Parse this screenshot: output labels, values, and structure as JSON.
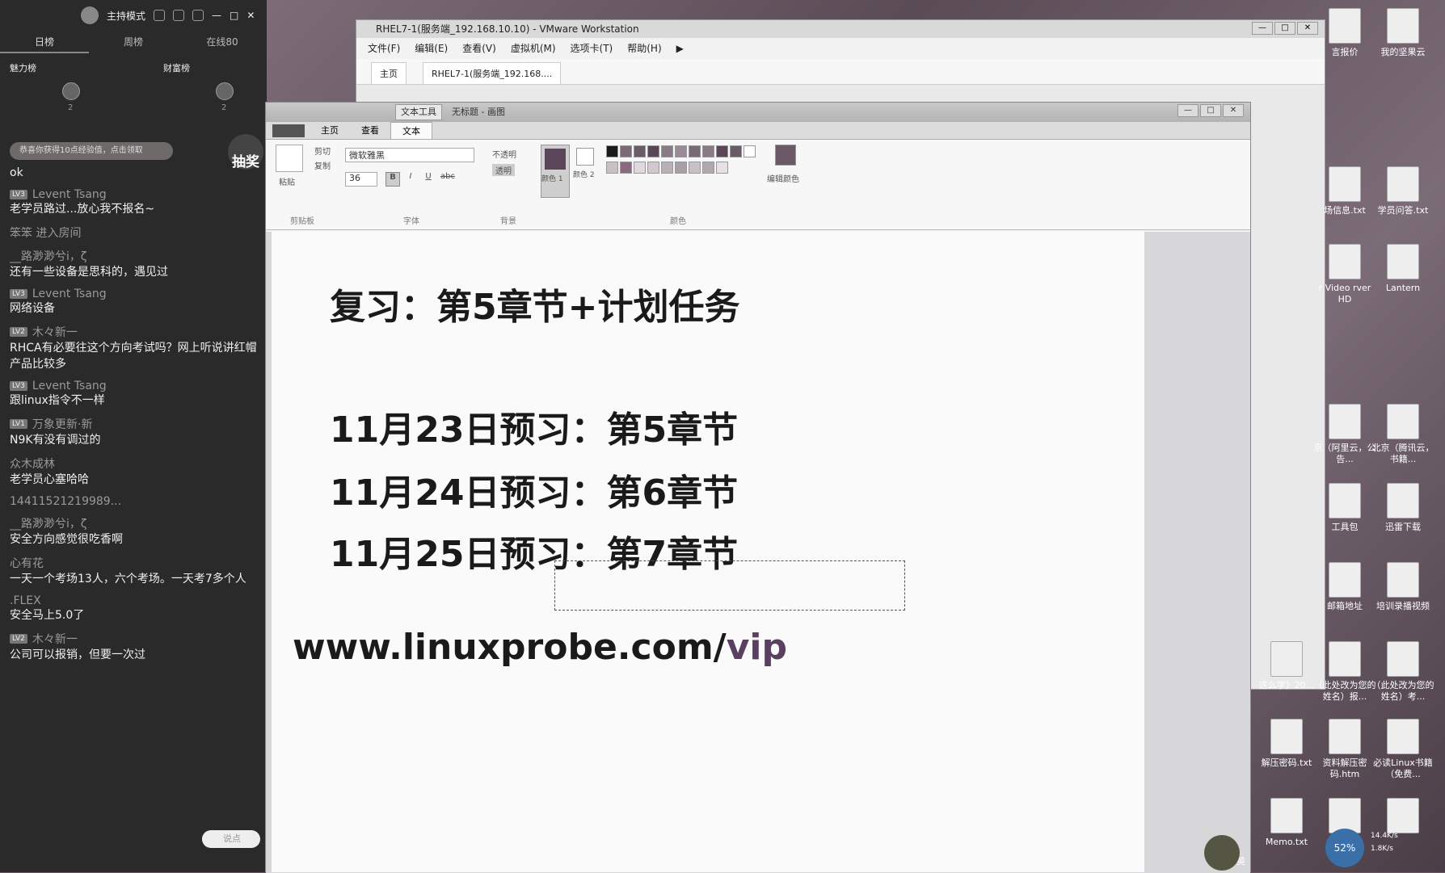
{
  "live": {
    "mode": "主持模式",
    "tabs": [
      "日榜",
      "周榜",
      "在线80"
    ],
    "rank_left": "魅力榜",
    "rank_right": "财富榜",
    "rank_left_count": "2",
    "rank_right_count": "2",
    "promo": "恭喜你获得10点经验值，点击领取",
    "lottery": "抽奖",
    "first_msg": "ok",
    "messages": [
      {
        "user": "Levent Tsang",
        "badge": "LV3",
        "text": "老学员路过...放心我不报名~"
      },
      {
        "system": "笨笨 进入房间"
      },
      {
        "user": "__路渺渺兮i，ζ",
        "badge": "",
        "text": "还有一些设备是思科的，遇见过"
      },
      {
        "user": "Levent Tsang",
        "badge": "LV3",
        "text": "网络设备"
      },
      {
        "user": "木々新一",
        "badge": "LV2",
        "text": "RHCA有必要往这个方向考试吗？网上听说讲红帽产品比较多"
      },
      {
        "user": "Levent Tsang",
        "badge": "LV3",
        "text": "跟linux指令不一样"
      },
      {
        "user": "万象更新·新",
        "badge": "LV1",
        "text": "N9K有没有调过的"
      },
      {
        "user": "众木成林",
        "badge": "",
        "text": "老学员心塞哈哈"
      },
      {
        "user": "14411521219989...",
        "badge": "",
        "text": ""
      },
      {
        "user": "__路渺渺兮i，ζ",
        "badge": "",
        "text": "安全方向感觉很吃香啊"
      },
      {
        "user": "心有花",
        "badge": "",
        "text": "一天一个考场13人，六个考场。一天考7多个人"
      },
      {
        "user": ".FLEX",
        "badge": "",
        "text": "安全马上5.0了"
      },
      {
        "user": "木々新一",
        "badge": "LV2",
        "text": "公司可以报销，但要一次过"
      }
    ],
    "input_placeholder": "说点"
  },
  "vmware": {
    "title": "RHEL7-1(服务端_192.168.10.10) - VMware Workstation",
    "menu": [
      "文件(F)",
      "编辑(E)",
      "查看(V)",
      "虚拟机(M)",
      "选项卡(T)",
      "帮助(H)"
    ],
    "home_tab": "主页",
    "vm_tab": "RHEL7-1(服务端_192.168...."
  },
  "paint": {
    "context_tab": "文本工具",
    "doc_title": "无标题 - 画图",
    "ribbon_tabs": [
      "主页",
      "查看",
      "文本"
    ],
    "active_tab": "文本",
    "clipboard": {
      "paste": "粘贴",
      "cut": "剪切",
      "copy": "复制",
      "label": "剪贴板"
    },
    "font": {
      "name": "微软雅黑",
      "size": "36",
      "label": "字体"
    },
    "background": {
      "opaque": "不透明",
      "transparent": "透明",
      "label": "背景"
    },
    "colors": {
      "color1": "颜色 1",
      "color2": "颜色 2",
      "edit": "编辑颜色",
      "label": "颜色"
    },
    "palette": [
      "#1a1a1a",
      "#7a6a78",
      "#6b5a68",
      "#5a4658",
      "#8a7a88",
      "#9a8a98",
      "#7a6a78",
      "#8a7a88",
      "#5a4658",
      "#6b5a68",
      "#ffffff",
      "#c8c0c6",
      "#8a6a80",
      "#e0d8de",
      "#d0c8ce",
      "#b8b0b6",
      "#a89ea6",
      "#c8c0c6",
      "#b0a8ae",
      "#e8e0e6"
    ],
    "canvas_lines": [
      "复习：第5章节+计划任务",
      "11月23日预习：第5章节",
      "11月24日预习：第6章节",
      "11月25日预习：第7章节"
    ],
    "url_main": "www.linuxprobe.com/",
    "url_tail": "vip",
    "url_tail_color": "#5a4060"
  },
  "desktop": {
    "icons": [
      {
        "label": "言报价",
        "name": "quote-icon"
      },
      {
        "label": "我的坚果云",
        "name": "nutstore-icon"
      },
      {
        "label": "场信息.txt",
        "name": "txt-file-icon"
      },
      {
        "label": "学员问答.txt",
        "name": "txt-file-icon"
      },
      {
        "label": "r Video rver HD",
        "name": "video-icon"
      },
      {
        "label": "Lantern",
        "name": "lantern-icon"
      },
      {
        "label": "京（阿里云，公告...",
        "name": "remote-icon"
      },
      {
        "label": "北京（腾讯云，书籍...",
        "name": "remote-icon"
      },
      {
        "label": "工具包",
        "name": "folder-icon"
      },
      {
        "label": "迅雷下载",
        "name": "folder-icon"
      },
      {
        "label": "邮箱地址",
        "name": "folder-icon"
      },
      {
        "label": "培训录播视频",
        "name": "folder-icon"
      },
      {
        "label": "这么学》20...",
        "name": "word-icon"
      },
      {
        "label": "（此处改为您的姓名）报...",
        "name": "word-icon"
      },
      {
        "label": "（此处改为您的姓名）考...",
        "name": "word-icon"
      },
      {
        "label": "解压密码.txt",
        "name": "txt-file-icon"
      },
      {
        "label": "资料解压密码.htm",
        "name": "ie-icon"
      },
      {
        "label": "必读Linux书籍（免费...",
        "name": "ie-icon"
      },
      {
        "label": "Memo.txt",
        "name": "txt-file-icon"
      },
      {
        "label": "",
        "name": "qr-icon"
      },
      {
        "label": "",
        "name": "excel-icon"
      }
    ],
    "tray": {
      "cpu": "52%",
      "up": "14.4K/s",
      "down": "1.8K/s",
      "ime": "英"
    }
  }
}
